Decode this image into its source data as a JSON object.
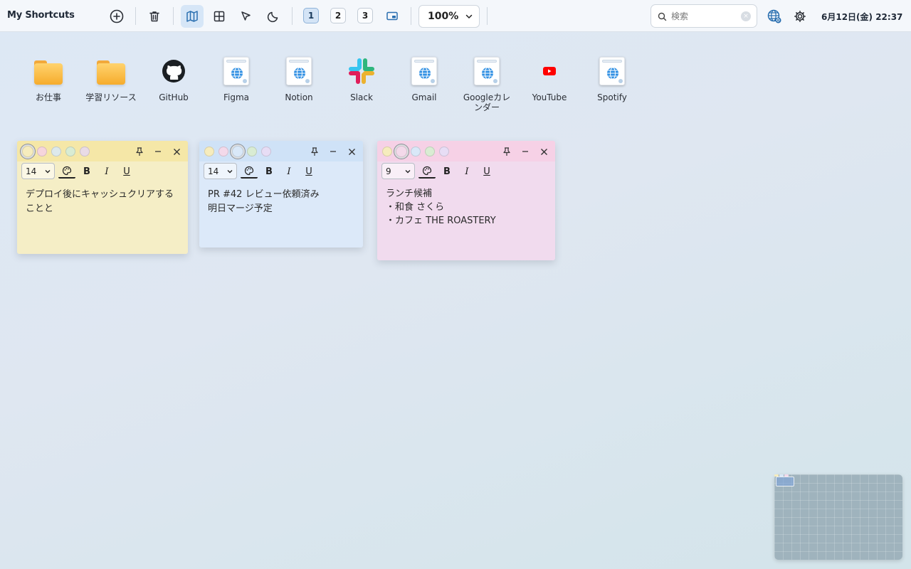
{
  "app": {
    "title": "My Shortcuts"
  },
  "toolbar": {
    "pages": [
      "1",
      "2",
      "3"
    ],
    "zoom": "100%",
    "search_placeholder": "検索",
    "clock": "6月12日(金) 22:37"
  },
  "shortcuts": [
    {
      "label": "お仕事",
      "icon": "folder-icon"
    },
    {
      "label": "学習リソース",
      "icon": "folder-icon"
    },
    {
      "label": "GitHub",
      "icon": "github-icon"
    },
    {
      "label": "Figma",
      "icon": "webpage-icon"
    },
    {
      "label": "Notion",
      "icon": "webpage-icon"
    },
    {
      "label": "Slack",
      "icon": "slack-icon"
    },
    {
      "label": "Gmail",
      "icon": "webpage-icon"
    },
    {
      "label": "Googleカレンダー",
      "icon": "webpage-icon"
    },
    {
      "label": "YouTube",
      "icon": "youtube-icon"
    },
    {
      "label": "Spotify",
      "icon": "webpage-icon"
    }
  ],
  "notes": [
    {
      "font_size": "14",
      "color": "#f6ecbd",
      "text": "デプロイ後にキャッシュクリアすることと"
    },
    {
      "font_size": "14",
      "color": "#d9e8f8",
      "text": "PR #42 レビュー依頼済み\n明日マージ予定"
    },
    {
      "font_size": "9",
      "color": "#f3d9ea",
      "text": "ランチ候補\n・和食 さくら\n・カフェ THE ROASTERY"
    }
  ],
  "colors": {
    "accent": "#2a6fb0",
    "note_yellow": "#f6ecbd",
    "note_blue": "#d9e8f8",
    "note_pink": "#f3d9ea"
  }
}
